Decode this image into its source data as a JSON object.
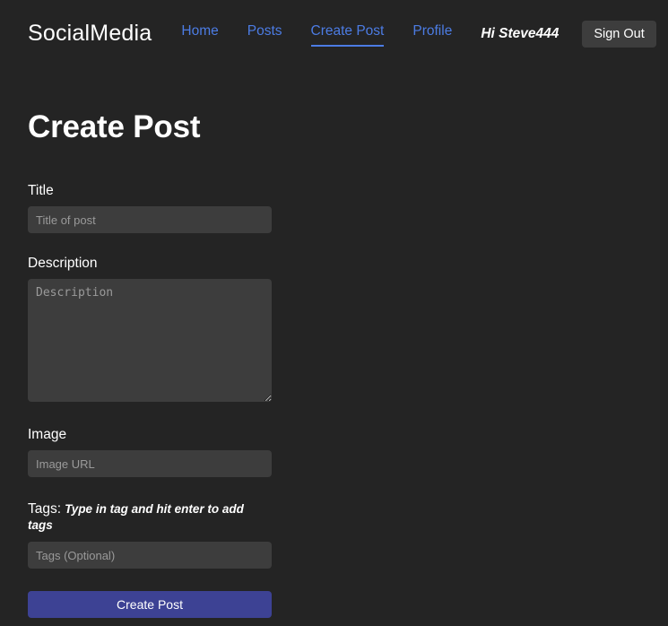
{
  "navbar": {
    "brand": "SocialMedia",
    "links": [
      {
        "label": "Home",
        "active": false
      },
      {
        "label": "Posts",
        "active": false
      },
      {
        "label": "Create Post",
        "active": true
      },
      {
        "label": "Profile",
        "active": false
      }
    ],
    "greeting": "Hi Steve444",
    "signout_label": "Sign Out",
    "link_color": "#4c7ce4",
    "signout_bg": "#3d3d3d"
  },
  "page": {
    "title": "Create Post",
    "background": "#242424"
  },
  "form": {
    "title_label": "Title",
    "title_placeholder": "Title of post",
    "title_value": "",
    "description_label": "Description",
    "description_placeholder": "Description",
    "description_value": "",
    "image_label": "Image",
    "image_placeholder": "Image URL",
    "image_value": "",
    "tags_label": "Tags:",
    "tags_hint": "Type in tag and hit enter to add tags",
    "tags_placeholder": "Tags (Optional)",
    "tags_value": "",
    "submit_label": "Create Post",
    "submit_color": "#3d4294",
    "input_bg": "#3d3d3d"
  }
}
